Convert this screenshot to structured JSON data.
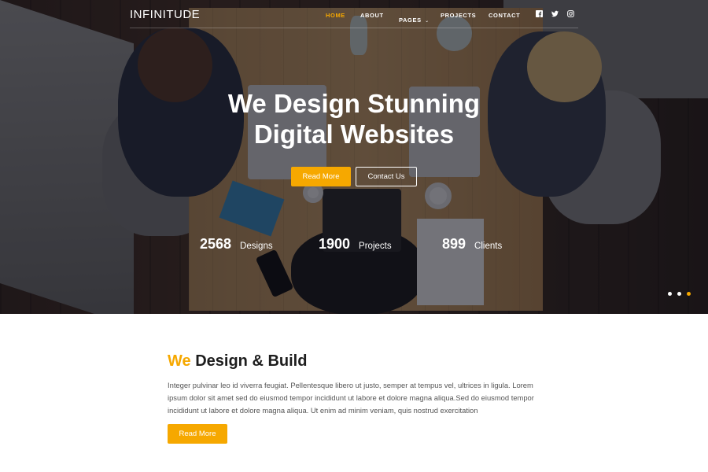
{
  "header": {
    "logo": "INFINITUDE",
    "menu": [
      {
        "label": "HOME",
        "active": true
      },
      {
        "label": "ABOUT",
        "active": false
      },
      {
        "label": "PAGES",
        "active": false,
        "dropdown": true
      },
      {
        "label": "PROJECTS",
        "active": false
      },
      {
        "label": "CONTACT",
        "active": false
      }
    ],
    "socials": [
      "facebook-icon",
      "twitter-icon",
      "instagram-icon"
    ]
  },
  "hero": {
    "title_line1": "We Design Stunning",
    "title_line2": "Digital Websites",
    "primary_button": "Read More",
    "secondary_button": "Contact Us",
    "stats": [
      {
        "value": "2568",
        "label": "Designs"
      },
      {
        "value": "1900",
        "label": "Projects"
      },
      {
        "value": "899",
        "label": "Clients"
      }
    ],
    "slider_dots": 3,
    "active_dot": 3
  },
  "content": {
    "title_accent": "We",
    "title_rest": "Design & Build",
    "paragraph": "Integer pulvinar leo id viverra feugiat. Pellentesque libero ut justo, semper at tempus vel, ultrices in ligula. Lorem ipsum dolor sit amet sed do eiusmod tempor incididunt ut labore et dolore magna aliqua.Sed do eiusmod tempor incididunt ut labore et dolore magna aliqua. Ut enim ad minim veniam, quis nostrud exercitation",
    "button": "Read More"
  },
  "colors": {
    "accent": "#f6a800",
    "heading": "#1d1d1d",
    "body_text": "#555555"
  }
}
